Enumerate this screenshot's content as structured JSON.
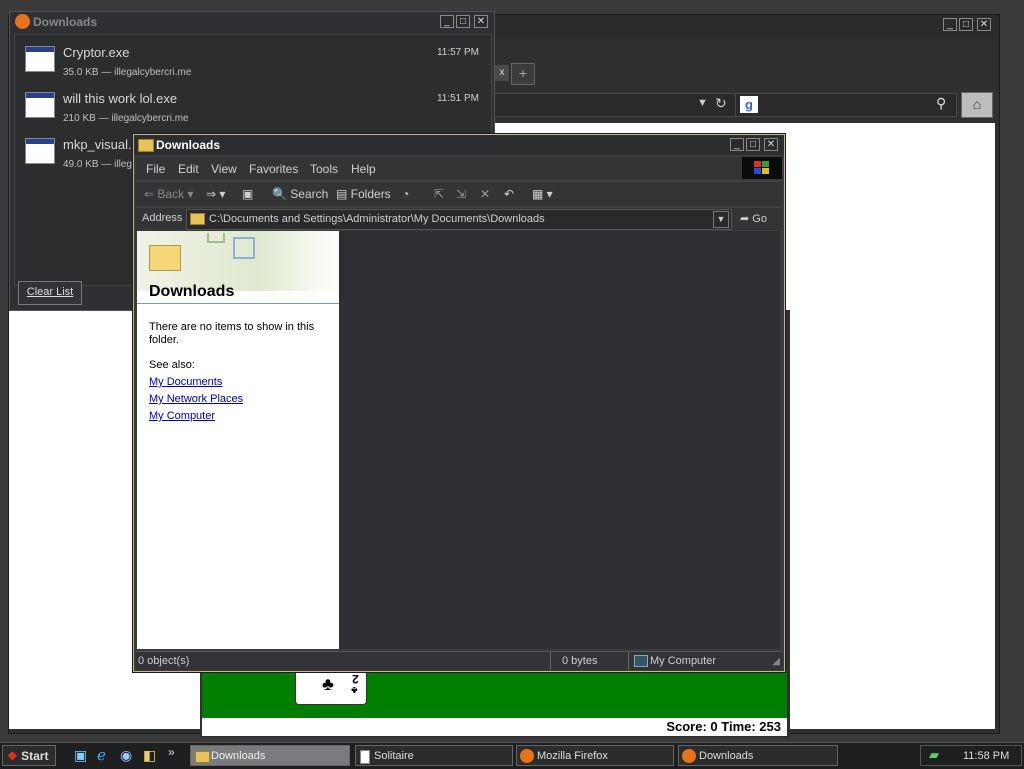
{
  "firefox_window": {
    "tab_new_symbol": "+",
    "tab_close_symbol": "x"
  },
  "solitaire": {
    "score_text": "Score: 0 Time: 253"
  },
  "downloads_manager": {
    "title": "Downloads",
    "items": [
      {
        "name": "Cryptor.exe",
        "meta": "35.0 KB — illegalcybercri.me",
        "time": "11:57 PM"
      },
      {
        "name": "will this work lol.exe",
        "meta": "210 KB — illegalcybercri.me",
        "time": "11:51 PM"
      },
      {
        "name": "mkp_visual...",
        "meta": "49.0 KB — illeg",
        "time": ""
      }
    ],
    "clear_button": "Clear List"
  },
  "explorer": {
    "title": "Downloads",
    "menu": [
      "File",
      "Edit",
      "View",
      "Favorites",
      "Tools",
      "Help"
    ],
    "toolbar": {
      "back": "Back",
      "search": "Search",
      "folders": "Folders"
    },
    "address_label": "Address",
    "address_value": "C:\\Documents and Settings\\Administrator\\My Documents\\Downloads",
    "go_label": "Go",
    "left_pane": {
      "heading": "Downloads",
      "empty_message": "There are no items to show in this folder.",
      "see_also": "See also:",
      "links": [
        "My Documents",
        "My Network Places",
        "My Computer"
      ]
    },
    "status": {
      "objects": "0 object(s)",
      "size": "0 bytes",
      "location": "My Computer"
    }
  },
  "taskbar": {
    "start": "Start",
    "chevron": "»",
    "tasks": [
      "Downloads",
      "Solitaire",
      "Mozilla Firefox",
      "Downloads"
    ],
    "clock": "11:58 PM"
  },
  "colors": {
    "felt_green": "#007e00",
    "link_blue": "#0000aa",
    "window_dark": "#2f3033"
  }
}
